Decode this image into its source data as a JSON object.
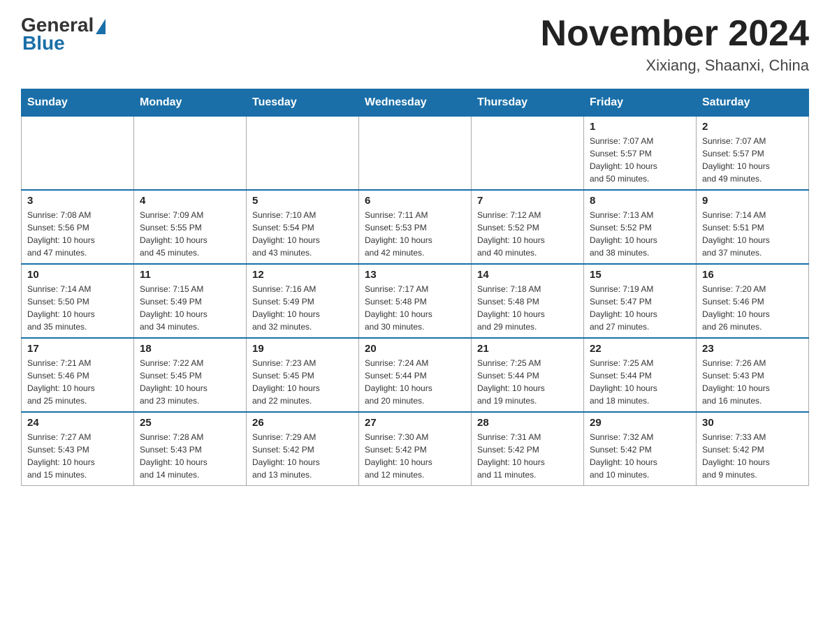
{
  "logo": {
    "general": "General",
    "blue": "Blue"
  },
  "title": "November 2024",
  "location": "Xixiang, Shaanxi, China",
  "days_of_week": [
    "Sunday",
    "Monday",
    "Tuesday",
    "Wednesday",
    "Thursday",
    "Friday",
    "Saturday"
  ],
  "weeks": [
    [
      {
        "day": "",
        "info": ""
      },
      {
        "day": "",
        "info": ""
      },
      {
        "day": "",
        "info": ""
      },
      {
        "day": "",
        "info": ""
      },
      {
        "day": "",
        "info": ""
      },
      {
        "day": "1",
        "info": "Sunrise: 7:07 AM\nSunset: 5:57 PM\nDaylight: 10 hours\nand 50 minutes."
      },
      {
        "day": "2",
        "info": "Sunrise: 7:07 AM\nSunset: 5:57 PM\nDaylight: 10 hours\nand 49 minutes."
      }
    ],
    [
      {
        "day": "3",
        "info": "Sunrise: 7:08 AM\nSunset: 5:56 PM\nDaylight: 10 hours\nand 47 minutes."
      },
      {
        "day": "4",
        "info": "Sunrise: 7:09 AM\nSunset: 5:55 PM\nDaylight: 10 hours\nand 45 minutes."
      },
      {
        "day": "5",
        "info": "Sunrise: 7:10 AM\nSunset: 5:54 PM\nDaylight: 10 hours\nand 43 minutes."
      },
      {
        "day": "6",
        "info": "Sunrise: 7:11 AM\nSunset: 5:53 PM\nDaylight: 10 hours\nand 42 minutes."
      },
      {
        "day": "7",
        "info": "Sunrise: 7:12 AM\nSunset: 5:52 PM\nDaylight: 10 hours\nand 40 minutes."
      },
      {
        "day": "8",
        "info": "Sunrise: 7:13 AM\nSunset: 5:52 PM\nDaylight: 10 hours\nand 38 minutes."
      },
      {
        "day": "9",
        "info": "Sunrise: 7:14 AM\nSunset: 5:51 PM\nDaylight: 10 hours\nand 37 minutes."
      }
    ],
    [
      {
        "day": "10",
        "info": "Sunrise: 7:14 AM\nSunset: 5:50 PM\nDaylight: 10 hours\nand 35 minutes."
      },
      {
        "day": "11",
        "info": "Sunrise: 7:15 AM\nSunset: 5:49 PM\nDaylight: 10 hours\nand 34 minutes."
      },
      {
        "day": "12",
        "info": "Sunrise: 7:16 AM\nSunset: 5:49 PM\nDaylight: 10 hours\nand 32 minutes."
      },
      {
        "day": "13",
        "info": "Sunrise: 7:17 AM\nSunset: 5:48 PM\nDaylight: 10 hours\nand 30 minutes."
      },
      {
        "day": "14",
        "info": "Sunrise: 7:18 AM\nSunset: 5:48 PM\nDaylight: 10 hours\nand 29 minutes."
      },
      {
        "day": "15",
        "info": "Sunrise: 7:19 AM\nSunset: 5:47 PM\nDaylight: 10 hours\nand 27 minutes."
      },
      {
        "day": "16",
        "info": "Sunrise: 7:20 AM\nSunset: 5:46 PM\nDaylight: 10 hours\nand 26 minutes."
      }
    ],
    [
      {
        "day": "17",
        "info": "Sunrise: 7:21 AM\nSunset: 5:46 PM\nDaylight: 10 hours\nand 25 minutes."
      },
      {
        "day": "18",
        "info": "Sunrise: 7:22 AM\nSunset: 5:45 PM\nDaylight: 10 hours\nand 23 minutes."
      },
      {
        "day": "19",
        "info": "Sunrise: 7:23 AM\nSunset: 5:45 PM\nDaylight: 10 hours\nand 22 minutes."
      },
      {
        "day": "20",
        "info": "Sunrise: 7:24 AM\nSunset: 5:44 PM\nDaylight: 10 hours\nand 20 minutes."
      },
      {
        "day": "21",
        "info": "Sunrise: 7:25 AM\nSunset: 5:44 PM\nDaylight: 10 hours\nand 19 minutes."
      },
      {
        "day": "22",
        "info": "Sunrise: 7:25 AM\nSunset: 5:44 PM\nDaylight: 10 hours\nand 18 minutes."
      },
      {
        "day": "23",
        "info": "Sunrise: 7:26 AM\nSunset: 5:43 PM\nDaylight: 10 hours\nand 16 minutes."
      }
    ],
    [
      {
        "day": "24",
        "info": "Sunrise: 7:27 AM\nSunset: 5:43 PM\nDaylight: 10 hours\nand 15 minutes."
      },
      {
        "day": "25",
        "info": "Sunrise: 7:28 AM\nSunset: 5:43 PM\nDaylight: 10 hours\nand 14 minutes."
      },
      {
        "day": "26",
        "info": "Sunrise: 7:29 AM\nSunset: 5:42 PM\nDaylight: 10 hours\nand 13 minutes."
      },
      {
        "day": "27",
        "info": "Sunrise: 7:30 AM\nSunset: 5:42 PM\nDaylight: 10 hours\nand 12 minutes."
      },
      {
        "day": "28",
        "info": "Sunrise: 7:31 AM\nSunset: 5:42 PM\nDaylight: 10 hours\nand 11 minutes."
      },
      {
        "day": "29",
        "info": "Sunrise: 7:32 AM\nSunset: 5:42 PM\nDaylight: 10 hours\nand 10 minutes."
      },
      {
        "day": "30",
        "info": "Sunrise: 7:33 AM\nSunset: 5:42 PM\nDaylight: 10 hours\nand 9 minutes."
      }
    ]
  ]
}
